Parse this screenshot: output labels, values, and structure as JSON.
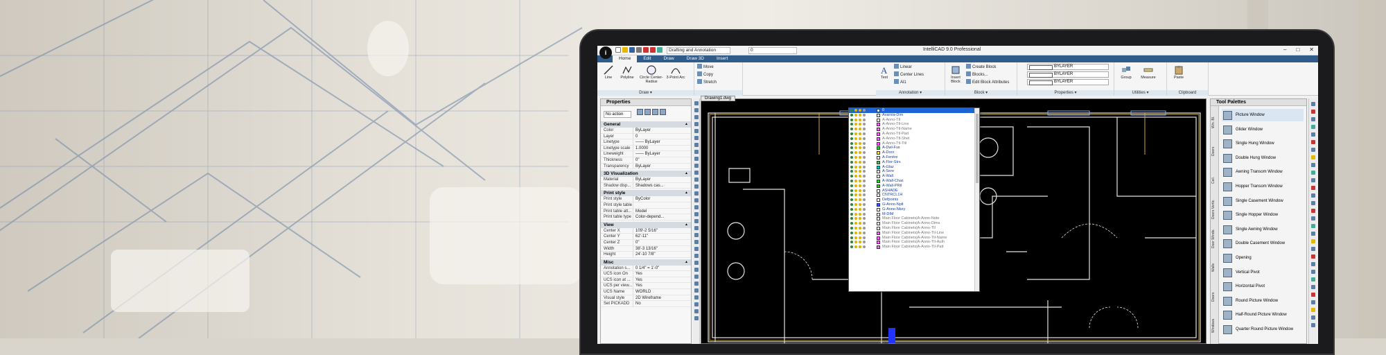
{
  "app": {
    "title": "IntelliCAD 9.0 Professional",
    "workspace": "Drafting and Annotation",
    "current_layer": "0",
    "window_buttons": [
      "–",
      "□",
      "✕"
    ]
  },
  "ribbon_tabs": [
    "Home",
    "Edit",
    "Draw",
    "Draw 3D",
    "Insert"
  ],
  "ribbon": {
    "draw": {
      "line": "Line",
      "polyline": "Polyline",
      "circle": "Circle Center-Radius",
      "arc": "3-Point Arc",
      "group_label": "Draw ▾"
    },
    "modify": {
      "move": "Move",
      "copy": "Copy",
      "stretch": "Stretch"
    },
    "annotation": {
      "text": "Text",
      "linear": "Linear",
      "center_lines": "Center Lines",
      "aligned": "Al1",
      "group_label": "Annotation ▾"
    },
    "block": {
      "insert": "Insert Block",
      "create": "Create Block",
      "blocks": "Blocks...",
      "edit_attr": "Edit Block Attributes",
      "group_label": "Block ▾"
    },
    "properties": {
      "color": "BYLAYER",
      "linetype": "BYLAYER",
      "lineweight": "BYLAYER",
      "group_label": "Properties ▾"
    },
    "utilities": {
      "group": "Group",
      "measure": "Measure",
      "group_label": "Utilities ▾"
    },
    "clipboard": {
      "paste": "Paste",
      "group_label": "Clipboard"
    }
  },
  "properties_panel": {
    "title": "Properties",
    "selection": "No action",
    "sections": [
      {
        "name": "General",
        "rows": [
          [
            "Color",
            "ByLayer"
          ],
          [
            "Layer",
            "0"
          ],
          [
            "Linetype",
            "—— ByLayer"
          ],
          [
            "Linetype scale",
            "1.0000"
          ],
          [
            "Lineweight",
            "—— ByLayer"
          ],
          [
            "Thickness",
            "0\""
          ],
          [
            "Transparency",
            "ByLayer"
          ]
        ]
      },
      {
        "name": "3D Visualization",
        "rows": [
          [
            "Material",
            "ByLayer"
          ],
          [
            "Shadow disp...",
            "Shadows cas..."
          ]
        ]
      },
      {
        "name": "Print style",
        "rows": [
          [
            "Print style",
            "ByColor"
          ],
          [
            "Print style table",
            ""
          ],
          [
            "Print table att...",
            "Model"
          ],
          [
            "Print table type",
            "Color-depend..."
          ]
        ]
      },
      {
        "name": "View",
        "rows": [
          [
            "Center X",
            "109'-2 5/16\""
          ],
          [
            "Center Y",
            "62'-11\""
          ],
          [
            "Center Z",
            "0\""
          ],
          [
            "Width",
            "38'-3 13/16\""
          ],
          [
            "Height",
            "24'-10 7/8\""
          ]
        ]
      },
      {
        "name": "Misc",
        "rows": [
          [
            "Annotation s...",
            "0 1/4\" = 1'-0\""
          ],
          [
            "UCS icon On",
            "Yes"
          ],
          [
            "UCS icon at ...",
            "Yes"
          ],
          [
            "UCS per view...",
            "Yes"
          ],
          [
            "UCS Name",
            "WORLD"
          ],
          [
            "Visual style",
            "2D Wireframe"
          ],
          [
            "Set PICKADD",
            "No"
          ]
        ]
      }
    ]
  },
  "drawing_tab": "Drawing1.dwg",
  "layer_list": [
    {
      "name": "0",
      "color": "#ffffff",
      "style": "sel"
    },
    {
      "name": "Avarnia-Dim",
      "color": "#ffffff",
      "style": "blue"
    },
    {
      "name": "A-Anno-Ttl",
      "color": "#ffffff",
      "style": "gray"
    },
    {
      "name": "A-Anno-Ttl-Line",
      "color": "#ff66ff",
      "style": "gray"
    },
    {
      "name": "A-Anno-Ttl-Name",
      "color": "#ff66ff",
      "style": "gray"
    },
    {
      "name": "A-Anno-Ttl-Part",
      "color": "#ff66ff",
      "style": "gray"
    },
    {
      "name": "A-Anno-Ttl-Shet",
      "color": "#ff66ff",
      "style": "gray"
    },
    {
      "name": "A-Anno-Ttl-Titl",
      "color": "#ff66ff",
      "style": "gray"
    },
    {
      "name": "A-Dwl-Fus",
      "color": "#33cc33",
      "style": "blue"
    },
    {
      "name": "A-Door",
      "color": "#ffee00",
      "style": "blue"
    },
    {
      "name": "A-Fenitre",
      "color": "#ffffff",
      "style": "blue"
    },
    {
      "name": "A-Flor-Strs",
      "color": "#33cc33",
      "style": "blue"
    },
    {
      "name": "A-Glaz",
      "color": "#00cccc",
      "style": "blue"
    },
    {
      "name": "A-Sere",
      "color": "#ffffff",
      "style": "blue"
    },
    {
      "name": "A-Wall",
      "color": "#ffffff",
      "style": "blue"
    },
    {
      "name": "A-Wall-Chas",
      "color": "#33cc33",
      "style": "blue"
    },
    {
      "name": "A-Wall-PRtl",
      "color": "#33cc33",
      "style": "blue"
    },
    {
      "name": "ASHADE",
      "color": "#ffffff",
      "style": "blue"
    },
    {
      "name": "CNTRCL1H",
      "color": "#ffffff",
      "style": "blue"
    },
    {
      "name": "Defpoints",
      "color": "#ffffff",
      "style": "blue"
    },
    {
      "name": "G-Anno-Nplt",
      "color": "#3355ff",
      "style": "blue"
    },
    {
      "name": "G-Anno-Nkey",
      "color": "#ffffff",
      "style": "blue"
    },
    {
      "name": "M-DIM",
      "color": "#ffffff",
      "style": "blue"
    },
    {
      "name": "Main Floor Cabinets|A-Anno-Note",
      "color": "#ffffff",
      "style": "gray"
    },
    {
      "name": "Main Floor Cabinets|A-Anno-Dims",
      "color": "#ffffff",
      "style": "gray"
    },
    {
      "name": "Main Floor Cabinets|A-Anno-Ttl",
      "color": "#ffffff",
      "style": "gray"
    },
    {
      "name": "Main Floor Cabinets|A-Anno-Ttl-Line",
      "color": "#ff66ff",
      "style": "gray"
    },
    {
      "name": "Main Floor Cabinets|A-Anno-Ttl-Name",
      "color": "#ff66ff",
      "style": "gray"
    },
    {
      "name": "Main Floor Cabinets|A-Anno-Ttl-Auth",
      "color": "#ff66ff",
      "style": "gray"
    },
    {
      "name": "Main Floor Cabinets|A-Anno-Ttl-Patt",
      "color": "#ff66ff",
      "style": "gray"
    }
  ],
  "tool_palettes": {
    "title": "Tool Palettes",
    "tabs": [
      "Win. Bl.",
      "Doors",
      "Ceil.",
      "Doors Vertic.",
      "Door Windo.",
      "Walls",
      "Doors",
      "Windows"
    ],
    "items": [
      "Picture Window",
      "Glider Window",
      "Single Hung Window",
      "Double Hung Window",
      "Awning Transom Window",
      "Hopper Transom Window",
      "Single Casement Window",
      "Single Hopper Window",
      "Single Awning Window",
      "Double Casement Window",
      "Opening",
      "Vertical Pivot",
      "Horizontal Pivot",
      "Round Picture Window",
      "Half-Round Picture Window",
      "Quarter Round Picture Window"
    ]
  },
  "colors": {
    "ribbon_tab_bar": "#2f5c8a",
    "selection": "#1e63d6",
    "canvas": "#000000"
  }
}
